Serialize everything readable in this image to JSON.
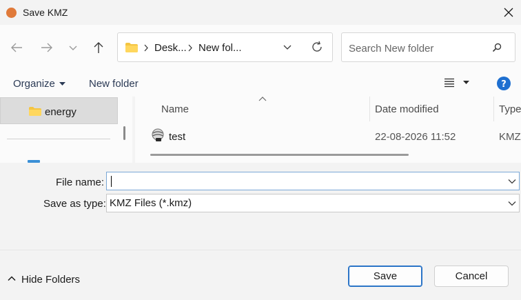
{
  "window": {
    "title": "Save KMZ",
    "accent": "#e07a3a"
  },
  "nav": {
    "address_segments": [
      "Desk...",
      "New fol..."
    ],
    "search_placeholder": "Search New folder"
  },
  "command_bar": {
    "organize_label": "Organize",
    "new_folder_label": "New folder"
  },
  "nav_pane": {
    "selected_item": "energy"
  },
  "file_list": {
    "columns": [
      "Name",
      "Date modified",
      "Type"
    ],
    "rows": [
      {
        "name": "test",
        "date_modified": "22-08-2026 11:52",
        "type": "KMZ"
      }
    ]
  },
  "form": {
    "file_name_label": "File name:",
    "file_name_value": "",
    "save_type_label": "Save as type:",
    "save_type_value": "KMZ Files (*.kmz)"
  },
  "footer": {
    "hide_folders_label": "Hide Folders",
    "save_label": "Save",
    "cancel_label": "Cancel"
  }
}
